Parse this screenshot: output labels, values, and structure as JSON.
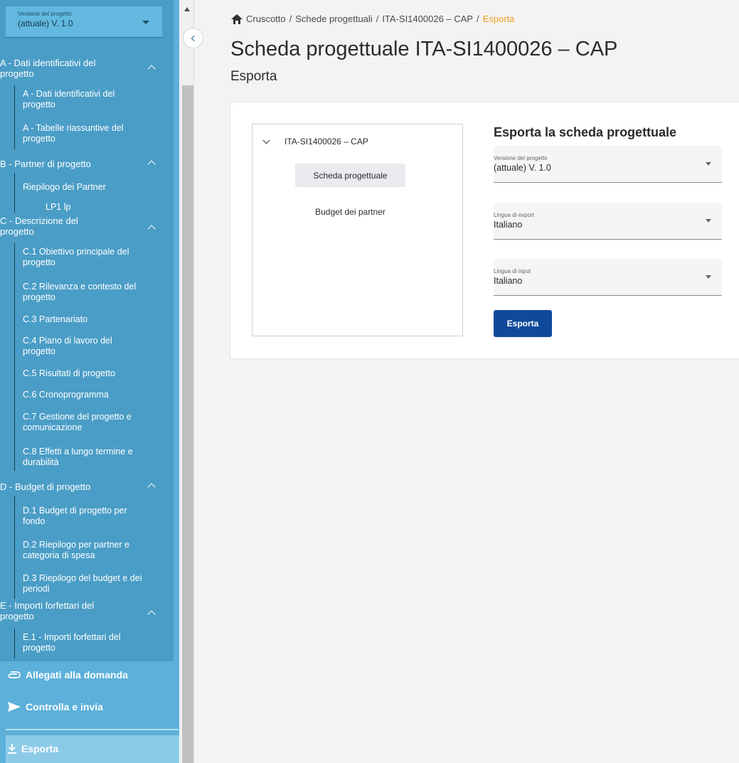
{
  "sidebar": {
    "version_select": {
      "label": "Versione del progetto",
      "value": "(attuale) V. 1.0"
    },
    "sections": [
      {
        "title_line1": "A - Dati identificativi del",
        "title_line2": "progetto",
        "items": [
          {
            "line1": "A - Dati identificativi del",
            "line2": "progetto"
          },
          {
            "line1": "A - Tabelle riassuntive del",
            "line2": "progetto"
          }
        ]
      },
      {
        "title_line1": "B - Partner di progetto",
        "items": [
          {
            "line1": "Riepilogo dei Partner"
          },
          {
            "line1": "LP1 lp"
          }
        ]
      },
      {
        "title_line1": "C - Descrizione del",
        "title_line2": "progetto",
        "items": [
          {
            "line1": "C.1 Obiettivo principale del",
            "line2": "progetto"
          },
          {
            "line1": "C.2 Rilevanza e contesto del",
            "line2": "progetto"
          },
          {
            "line1": "C.3 Partenariato"
          },
          {
            "line1": "C.4 Piano di lavoro del",
            "line2": "progetto"
          },
          {
            "line1": "C.5 Risultati di progetto"
          },
          {
            "line1": "C.6 Cronoprogramma"
          },
          {
            "line1": "C.7 Gestione del progetto e",
            "line2": "comunicazione"
          },
          {
            "line1": "C.8 Effetti a lungo termine e",
            "line2": "durabilità"
          }
        ]
      },
      {
        "title_line1": "D - Budget di progetto",
        "items": [
          {
            "line1": "D.1 Budget di progetto per",
            "line2": "fondo"
          },
          {
            "line1": "D.2 Riepilogo per partner e",
            "line2": "categoria di spesa"
          },
          {
            "line1": "D.3 Riepilogo del budget e dei",
            "line2": "periodi"
          }
        ]
      },
      {
        "title_line1": "E - Importi forfettari del",
        "title_line2": "progetto",
        "items": [
          {
            "line1": "E.1 - Importi forfettari del",
            "line2": "progetto"
          }
        ]
      }
    ],
    "bottom": {
      "allegati": "Allegati alla domanda",
      "controlla": "Controlla e invia",
      "esporta": "Esporta"
    }
  },
  "breadcrumb": {
    "items": [
      "Cruscotto",
      "Schede progettuali",
      "ITA-SI1400026 – CAP",
      "Esporta"
    ],
    "separator": "/"
  },
  "page": {
    "title": "Scheda progettuale ITA-SI1400026 – CAP",
    "subtitle": "Esporta"
  },
  "tree": {
    "root": "ITA-SI1400026 – CAP",
    "children": [
      "Scheda progettuale",
      "Budget dei partner"
    ]
  },
  "export": {
    "title": "Esporta la scheda progettuale",
    "version": {
      "label": "Versione del progetto",
      "value": "(attuale) V. 1.0"
    },
    "export_lang": {
      "label": "Lingua di export",
      "value": "Italiano"
    },
    "input_lang": {
      "label": "Lingua di input",
      "value": "Italiano"
    },
    "button": "Esporta"
  },
  "colors": {
    "sidebar": "#4a9dc6",
    "accent": "#f0a020",
    "primary_button": "#0f4a9a"
  }
}
